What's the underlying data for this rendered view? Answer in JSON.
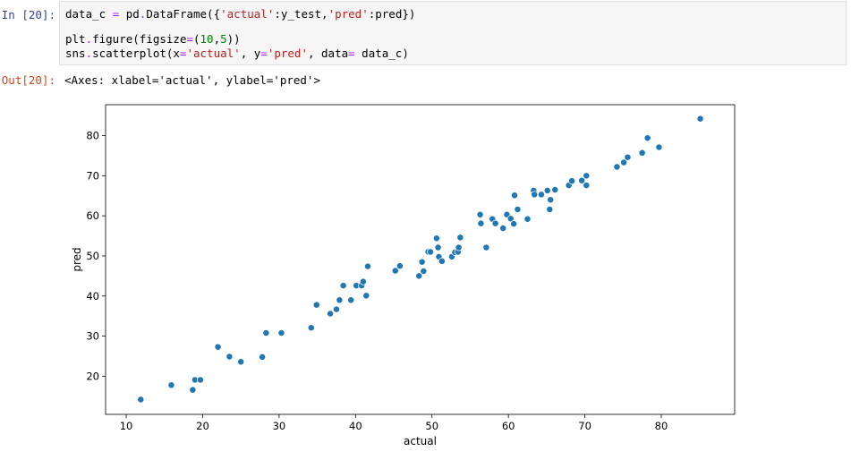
{
  "cell": {
    "in_prompt": "In [20]:",
    "out_prompt": "Out[20]:",
    "code_lines": [
      [
        {
          "t": "data_c "
        },
        {
          "t": "=",
          "c": "op"
        },
        {
          "t": " pd"
        },
        {
          "t": ".",
          "c": "op"
        },
        {
          "t": "DataFrame({"
        },
        {
          "t": "'actual'",
          "c": "str"
        },
        {
          "t": ":y_test,"
        },
        {
          "t": "'pred'",
          "c": "str"
        },
        {
          "t": ":pred})"
        }
      ],
      [],
      [
        {
          "t": "plt"
        },
        {
          "t": ".",
          "c": "op"
        },
        {
          "t": "figure(figsize"
        },
        {
          "t": "=",
          "c": "op"
        },
        {
          "t": "("
        },
        {
          "t": "10",
          "c": "num"
        },
        {
          "t": ","
        },
        {
          "t": "5",
          "c": "num"
        },
        {
          "t": "))"
        }
      ],
      [
        {
          "t": "sns"
        },
        {
          "t": ".",
          "c": "op"
        },
        {
          "t": "scatterplot(x"
        },
        {
          "t": "=",
          "c": "op"
        },
        {
          "t": "'actual'",
          "c": "str"
        },
        {
          "t": ", y"
        },
        {
          "t": "=",
          "c": "op"
        },
        {
          "t": "'pred'",
          "c": "str"
        },
        {
          "t": ", data"
        },
        {
          "t": "=",
          "c": "op"
        },
        {
          "t": " data_c)"
        }
      ]
    ],
    "output_text": "<Axes: xlabel='actual', ylabel='pred'>"
  },
  "colors": {
    "point": "#1f77b4",
    "in_prompt": "#303f9f",
    "out_prompt": "#d84315"
  },
  "chart_data": {
    "type": "scatter",
    "title": "",
    "xlabel": "actual",
    "ylabel": "pred",
    "xlim": [
      7.3,
      89.6
    ],
    "ylim": [
      10.5,
      87.7
    ],
    "xticks": [
      10,
      20,
      30,
      40,
      50,
      60,
      70,
      80
    ],
    "yticks": [
      20,
      30,
      40,
      50,
      60,
      70,
      80
    ],
    "grid": false,
    "series": [
      {
        "x": [
          11.9,
          15.9,
          18.7,
          19.0,
          19.7,
          22.0,
          23.5,
          25.0,
          27.8,
          28.3,
          30.3,
          34.2,
          34.9,
          36.7,
          37.5,
          37.9,
          38.4,
          39.4,
          40.1,
          40.8,
          41.0,
          41.4,
          41.6,
          45.2,
          45.8,
          48.3,
          48.7,
          48.9,
          49.5,
          49.8,
          50.6,
          50.8,
          50.9,
          51.3,
          52.6,
          53.0,
          53.4,
          53.5,
          53.7,
          56.3,
          56.4,
          57.1,
          57.9,
          58.3,
          59.3,
          59.8,
          60.3,
          60.7,
          60.8,
          61.2,
          62.5,
          63.3,
          63.4,
          64.3,
          65.1,
          65.4,
          65.5,
          66.1,
          67.9,
          68.3,
          69.6,
          70.2,
          70.2,
          74.2,
          75.1,
          75.6,
          77.5,
          78.2,
          79.7,
          85.1
        ],
        "y": [
          14.2,
          17.8,
          16.6,
          19.1,
          19.1,
          27.3,
          24.9,
          23.6,
          24.8,
          30.8,
          30.8,
          32.1,
          37.8,
          35.6,
          36.7,
          39.0,
          42.6,
          39.0,
          42.6,
          42.6,
          43.6,
          40.1,
          47.4,
          46.3,
          47.5,
          45.0,
          48.5,
          46.2,
          51.0,
          51.0,
          54.4,
          52.1,
          49.8,
          48.7,
          49.8,
          50.9,
          51.0,
          52.1,
          54.6,
          60.3,
          58.1,
          52.1,
          59.2,
          58.1,
          56.9,
          60.3,
          59.3,
          58.0,
          65.1,
          61.6,
          59.2,
          66.3,
          65.3,
          65.3,
          66.3,
          61.6,
          64.0,
          66.5,
          67.6,
          68.7,
          68.8,
          67.6,
          70.0,
          72.2,
          73.3,
          74.6,
          75.7,
          79.4,
          77.1,
          84.2
        ]
      }
    ]
  }
}
